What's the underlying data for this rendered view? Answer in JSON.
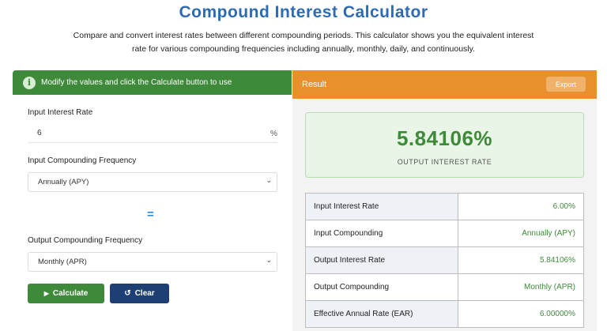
{
  "header": {
    "title": "Compound Interest Calculator",
    "description": "Compare and convert interest rates between different compounding periods. This calculator shows you the equivalent interest rate for various compounding frequencies including annually, monthly, daily, and continuously."
  },
  "form": {
    "info_text": "Modify the values and click the Calculate button to use",
    "input_rate_label": "Input Interest Rate",
    "input_rate_value": "6",
    "input_rate_unit": "%",
    "input_freq_label": "Input Compounding Frequency",
    "input_freq_selected": "Annually (APY)",
    "equals_symbol": "=",
    "output_freq_label": "Output Compounding Frequency",
    "output_freq_selected": "Monthly (APR)",
    "calculate_label": "Calculate",
    "clear_label": "Clear"
  },
  "result": {
    "title": "Result",
    "export_label": "Export",
    "value": "5.84106%",
    "caption": "OUTPUT INTEREST RATE",
    "rows": [
      {
        "label": "Input Interest Rate",
        "value": "6.00%"
      },
      {
        "label": "Input Compounding",
        "value": "Annually (APY)"
      },
      {
        "label": "Output Interest Rate",
        "value": "5.84106%"
      },
      {
        "label": "Output Compounding",
        "value": "Monthly (APR)"
      },
      {
        "label": "Effective Annual Rate (EAR)",
        "value": "6.00000%"
      }
    ]
  },
  "colors": {
    "green": "#3e8a3a",
    "orange": "#e8902e",
    "navy": "#1e3f73",
    "title_blue": "#2e6bb3"
  }
}
